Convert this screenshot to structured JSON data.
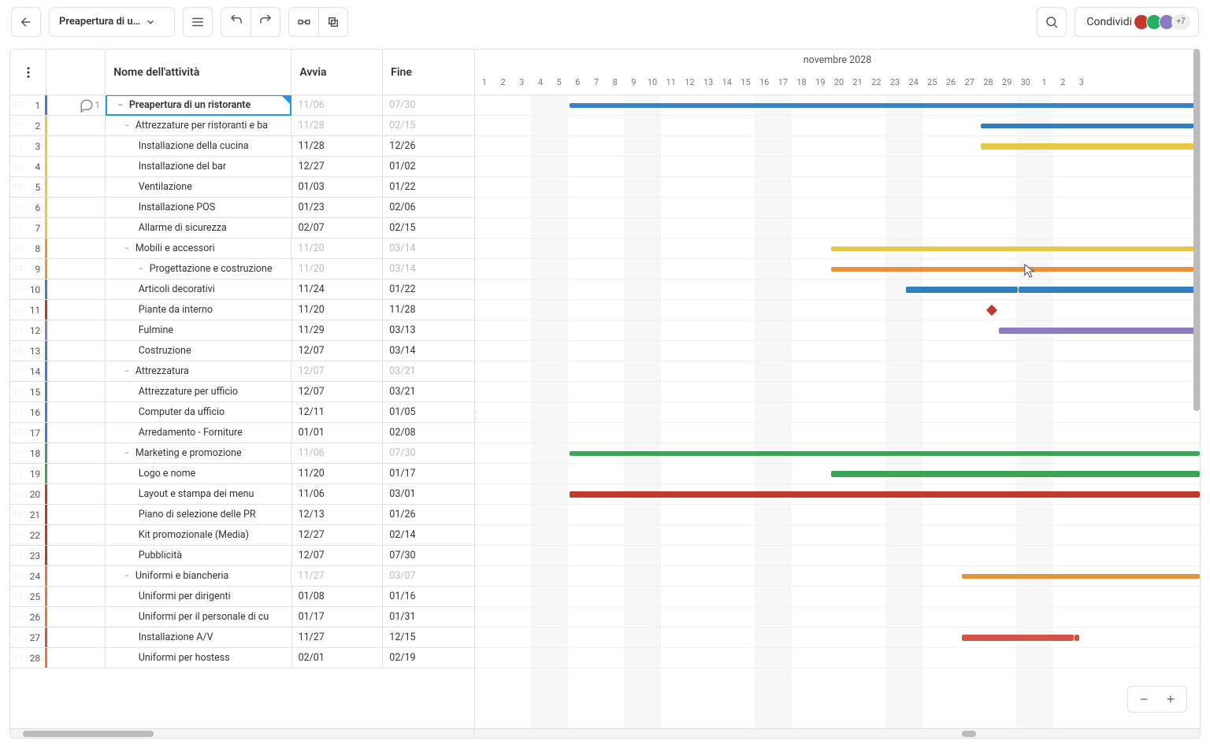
{
  "toolbar": {
    "project_name": "Preapertura di u…",
    "share_label": "Condividi",
    "avatar_more": "+7"
  },
  "grid": {
    "col_name": "Nome dell'attività",
    "col_start": "Avvia",
    "col_end": "Fine"
  },
  "timeline": {
    "month_label": "novembre 2028",
    "days": [
      "1",
      "2",
      "3",
      "4",
      "5",
      "6",
      "7",
      "8",
      "9",
      "10",
      "11",
      "12",
      "13",
      "14",
      "15",
      "16",
      "17",
      "18",
      "19",
      "20",
      "21",
      "22",
      "23",
      "24",
      "25",
      "26",
      "27",
      "28",
      "29",
      "30",
      "1",
      "2",
      "3"
    ]
  },
  "rows": [
    {
      "n": 1,
      "name": "Preapertura di un ristorante",
      "start": "11/06",
      "end": "07/30",
      "muted": true,
      "lvl": 0,
      "exp": true,
      "stripe": "#3b82c7",
      "comments": 1,
      "sel": true,
      "bar": {
        "c": "c-blue",
        "l": 120,
        "r": 0,
        "sum": true
      }
    },
    {
      "n": 2,
      "name": "Attrezzature per ristoranti e ba",
      "start": "11/28",
      "end": "02/15",
      "muted": true,
      "lvl": 1,
      "exp": true,
      "stripe": "#e9c843",
      "bar": {
        "c": "c-dblue",
        "l": 642,
        "r": 0,
        "sum": true
      }
    },
    {
      "n": 3,
      "name": "Installazione della cucina",
      "start": "11/28",
      "end": "12/26",
      "lvl": 2,
      "stripe": "#e9c843",
      "bar": {
        "c": "c-yellow",
        "l": 642,
        "r": 0
      }
    },
    {
      "n": 4,
      "name": "Installazione del bar",
      "start": "12/27",
      "end": "01/02",
      "lvl": 2,
      "stripe": "#e9c843"
    },
    {
      "n": 5,
      "name": "Ventilazione",
      "start": "01/03",
      "end": "01/22",
      "lvl": 2,
      "stripe": "#e9c843"
    },
    {
      "n": 6,
      "name": "Installazione POS",
      "start": "01/23",
      "end": "02/06",
      "lvl": 2,
      "stripe": "#e9c843"
    },
    {
      "n": 7,
      "name": "Allarme di sicurezza",
      "start": "02/07",
      "end": "02/15",
      "lvl": 2,
      "stripe": "#e9c843"
    },
    {
      "n": 8,
      "name": "Mobili e accessori",
      "start": "11/20",
      "end": "03/14",
      "muted": true,
      "lvl": 1,
      "exp": true,
      "stripe": "#e8933c",
      "bar": {
        "c": "c-yellow",
        "l": 452,
        "r": 0,
        "sum": true
      }
    },
    {
      "n": 9,
      "name": "Progettazione e costruzione",
      "start": "11/20",
      "end": "03/14",
      "muted": true,
      "lvl": 2,
      "exp": true,
      "stripe": "#e8933c",
      "bar": {
        "c": "c-orange",
        "l": 452,
        "r": 0,
        "sum": true
      }
    },
    {
      "n": 10,
      "name": "Articoli decorativi",
      "start": "11/24",
      "end": "01/22",
      "lvl": 2,
      "stripe": "#3b82c7",
      "bar": {
        "c": "c-dblue",
        "l": 547,
        "w": 142
      }
    },
    {
      "n": 11,
      "name": "Piante da interno",
      "start": "11/20",
      "end": "11/28",
      "lvl": 2,
      "stripe": "#c0392b",
      "milestone": 651
    },
    {
      "n": 12,
      "name": "Fulmine",
      "start": "11/29",
      "end": "03/13",
      "lvl": 2,
      "stripe": "#8d7dc0",
      "bar": {
        "c": "c-purple",
        "l": 665,
        "r": 0
      }
    },
    {
      "n": 13,
      "name": "Costruzione",
      "start": "12/07",
      "end": "03/14",
      "lvl": 2,
      "stripe": "#3b82c7"
    },
    {
      "n": 14,
      "name": "Attrezzatura",
      "start": "12/07",
      "end": "03/21",
      "muted": true,
      "lvl": 1,
      "exp": true,
      "stripe": "#3b82c7"
    },
    {
      "n": 15,
      "name": "Attrezzature per ufficio",
      "start": "12/07",
      "end": "03/21",
      "lvl": 2,
      "stripe": "#3b82c7"
    },
    {
      "n": 16,
      "name": "Computer da ufficio",
      "start": "12/11",
      "end": "01/05",
      "lvl": 2,
      "stripe": "#3b82c7"
    },
    {
      "n": 17,
      "name": "Arredamento - Forniture",
      "start": "01/01",
      "end": "02/08",
      "lvl": 2,
      "stripe": "#3b82c7"
    },
    {
      "n": 18,
      "name": "Marketing e promozione",
      "start": "11/06",
      "end": "07/30",
      "muted": true,
      "lvl": 1,
      "exp": true,
      "stripe": "#3aa655",
      "bar": {
        "c": "c-green",
        "l": 120,
        "r": 0,
        "sum": true
      }
    },
    {
      "n": 19,
      "name": "Logo e nome",
      "start": "11/20",
      "end": "01/17",
      "lvl": 2,
      "stripe": "#3aa655",
      "bar": {
        "c": "c-green",
        "l": 452,
        "r": 0
      }
    },
    {
      "n": 20,
      "name": "Layout e stampa dei menu",
      "start": "11/06",
      "end": "03/01",
      "lvl": 2,
      "stripe": "#c0392b",
      "bar": {
        "c": "c-red",
        "l": 120,
        "r": 0
      }
    },
    {
      "n": 21,
      "name": "Piano di selezione delle PR",
      "start": "12/13",
      "end": "01/26",
      "lvl": 2,
      "stripe": "#c0392b"
    },
    {
      "n": 22,
      "name": "Kit promozionale (Media)",
      "start": "12/27",
      "end": "02/14",
      "lvl": 2,
      "stripe": "#c0392b"
    },
    {
      "n": 23,
      "name": "Pubblicità",
      "start": "12/07",
      "end": "07/30",
      "lvl": 2,
      "stripe": "#c0392b"
    },
    {
      "n": 24,
      "name": "Uniformi e biancheria",
      "start": "11/27",
      "end": "03/07",
      "muted": true,
      "lvl": 1,
      "exp": true,
      "stripe": "#e07a3a",
      "bar": {
        "c": "c-orange",
        "l": 618,
        "r": 0,
        "sum": true
      }
    },
    {
      "n": 25,
      "name": "Uniformi per dirigenti",
      "start": "01/08",
      "end": "01/16",
      "lvl": 2,
      "stripe": "#e07a3a"
    },
    {
      "n": 26,
      "name": "Uniformi per il personale di cu",
      "start": "01/17",
      "end": "01/31",
      "lvl": 2,
      "stripe": "#e07a3a"
    },
    {
      "n": 27,
      "name": "Installazione A/V",
      "start": "11/27",
      "end": "12/15",
      "lvl": 2,
      "stripe": "#d35445",
      "bar": {
        "c": "c-red2",
        "l": 618,
        "w": 142
      }
    },
    {
      "n": 28,
      "name": "Uniformi per hostess",
      "start": "02/01",
      "end": "02/19",
      "lvl": 2,
      "stripe": "#e07a3a"
    }
  ]
}
